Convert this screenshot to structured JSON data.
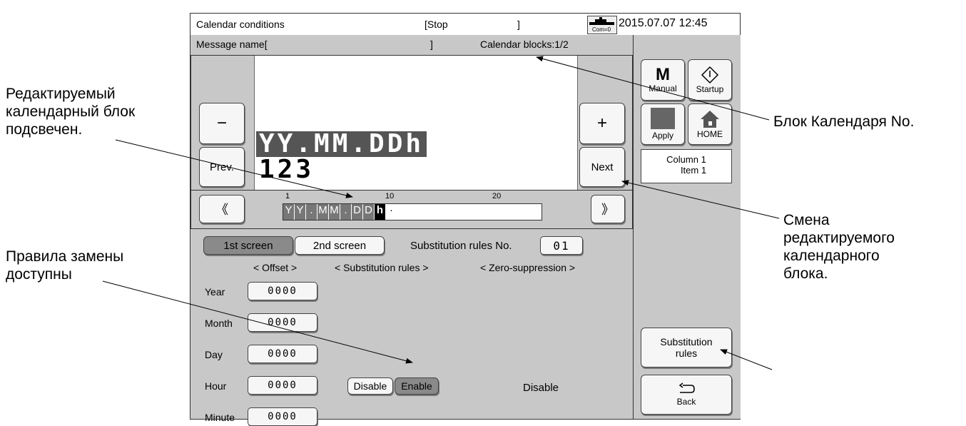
{
  "annotations": {
    "edited_block": [
      "Редактируемый",
      "календарный блок",
      "подсвечен."
    ],
    "calendar_block_no": "Блок Календаря No.",
    "change_block": [
      "Смена",
      "редактируемого",
      "календарного",
      "блока."
    ],
    "rules_available": [
      "Правила замены",
      "доступны"
    ]
  },
  "header": {
    "title": "Calendar conditions",
    "status": "[Stop",
    "status_close": "]",
    "com_label": "Com=0",
    "datetime": "2015.07.07 12:45"
  },
  "message_bar": {
    "name_label": "Message name[",
    "name_close": "]",
    "calendar_blocks": "Calendar blocks:1/2"
  },
  "preview": {
    "line1": "YY.MM.DDh",
    "line2": "123",
    "minus": "−",
    "prev": "Prev.",
    "plus": "+",
    "next": "Next"
  },
  "ruler": {
    "left_arrow": "《",
    "right_arrow": "》",
    "tick1": "1",
    "tick10": "10",
    "tick20": "20",
    "chars": [
      "Y",
      "Y",
      ".",
      "M",
      "M",
      ".",
      "D",
      "D",
      "h",
      "·"
    ]
  },
  "side": {
    "manual_m": "M",
    "manual": "Manual",
    "startup": "Startup",
    "apply": "Apply",
    "home": "HOME",
    "column": "Column 1",
    "item": "Item 1",
    "substitution_rules": [
      "Substitution",
      "rules"
    ],
    "back": "Back"
  },
  "tabs": {
    "first": "1st screen",
    "second": "2nd screen",
    "rules_no_label": "Substitution rules No.",
    "rules_no_value": "01"
  },
  "table": {
    "headers": [
      "< Offset >",
      "< Substitution rules >",
      "< Zero-suppression >"
    ],
    "rows": [
      {
        "label": "Year",
        "offset": "0000"
      },
      {
        "label": "Month",
        "offset": "0000"
      },
      {
        "label": "Day",
        "offset": "0000"
      },
      {
        "label": "Hour",
        "offset": "0000"
      },
      {
        "label": "Minute",
        "offset": "0000"
      }
    ],
    "disable": "Disable",
    "enable": "Enable",
    "zero_suppression": "Disable"
  }
}
